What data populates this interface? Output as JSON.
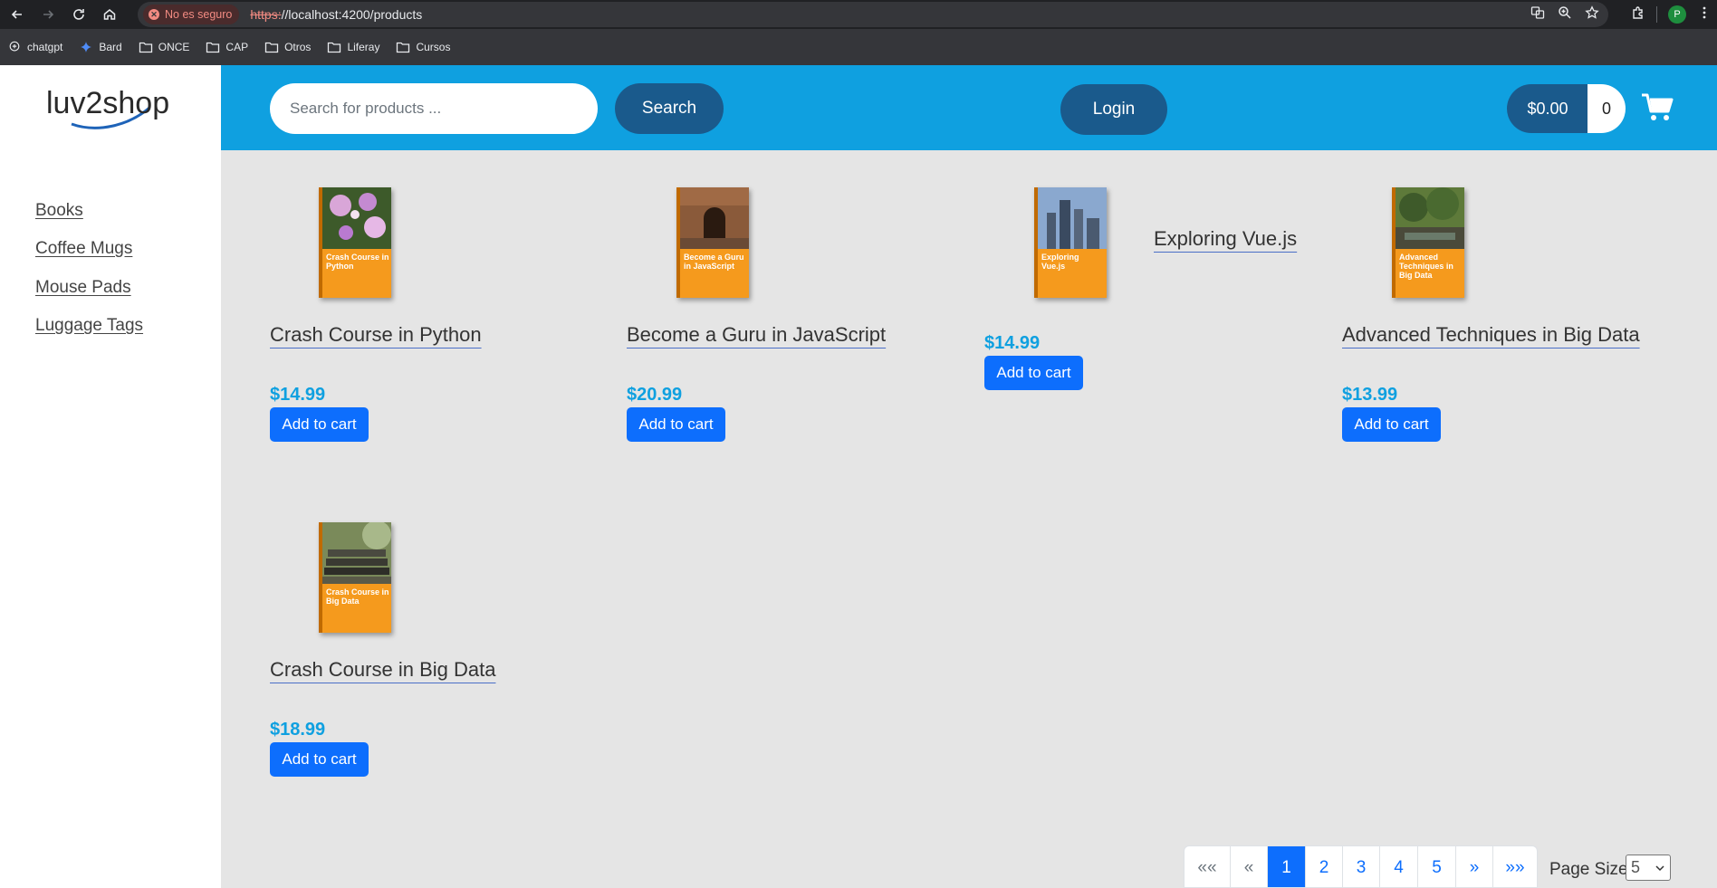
{
  "browser": {
    "security_label": "No es seguro",
    "url_scheme": "https:",
    "url_rest": "//localhost:4200/products",
    "bookmarks": [
      {
        "label": "chatgpt",
        "icon": "chatgpt-icon"
      },
      {
        "label": "Bard",
        "icon": "bard-icon"
      },
      {
        "label": "ONCE",
        "icon": "folder-icon"
      },
      {
        "label": "CAP",
        "icon": "folder-icon"
      },
      {
        "label": "Otros",
        "icon": "folder-icon"
      },
      {
        "label": "Liferay",
        "icon": "folder-icon"
      },
      {
        "label": "Cursos",
        "icon": "folder-icon"
      }
    ],
    "profile_initial": "P"
  },
  "app": {
    "logo": "luv2shop",
    "search_placeholder": "Search for products ...",
    "search_label": "Search",
    "login_label": "Login",
    "cart_total": "$0.00",
    "cart_count": "0",
    "colors": {
      "header": "#0fa0e0",
      "pill": "#1a5a8c",
      "button": "#0d6efd",
      "price": "#0fa0e0"
    }
  },
  "sidebar": {
    "items": [
      {
        "label": "Books"
      },
      {
        "label": "Coffee Mugs"
      },
      {
        "label": "Mouse Pads"
      },
      {
        "label": "Luggage Tags"
      }
    ]
  },
  "products": [
    {
      "name": "Crash Course in Python",
      "price": "$14.99",
      "cover_title": "Crash Course in Python",
      "add_label": "Add to cart"
    },
    {
      "name": "Become a Guru in JavaScript",
      "price": "$20.99",
      "cover_title": "Become a Guru in JavaScript",
      "add_label": "Add to cart"
    },
    {
      "name": "Exploring Vue.js",
      "price": "$14.99",
      "cover_title": "Exploring Vue.js",
      "add_label": "Add to cart"
    },
    {
      "name": "Advanced Techniques in Big Data",
      "price": "$13.99",
      "cover_title": "Advanced Techniques in Big Data",
      "add_label": "Add to cart"
    },
    {
      "name": "Crash Course in Big Data",
      "price": "$18.99",
      "cover_title": "Crash Course in Big Data",
      "add_label": "Add to cart"
    }
  ],
  "pagination": {
    "first": "««",
    "prev": "«",
    "pages": [
      "1",
      "2",
      "3",
      "4",
      "5"
    ],
    "active_page": "1",
    "next": "»",
    "last": "»»",
    "page_size_label": "Page Size",
    "page_size_value": "5"
  }
}
